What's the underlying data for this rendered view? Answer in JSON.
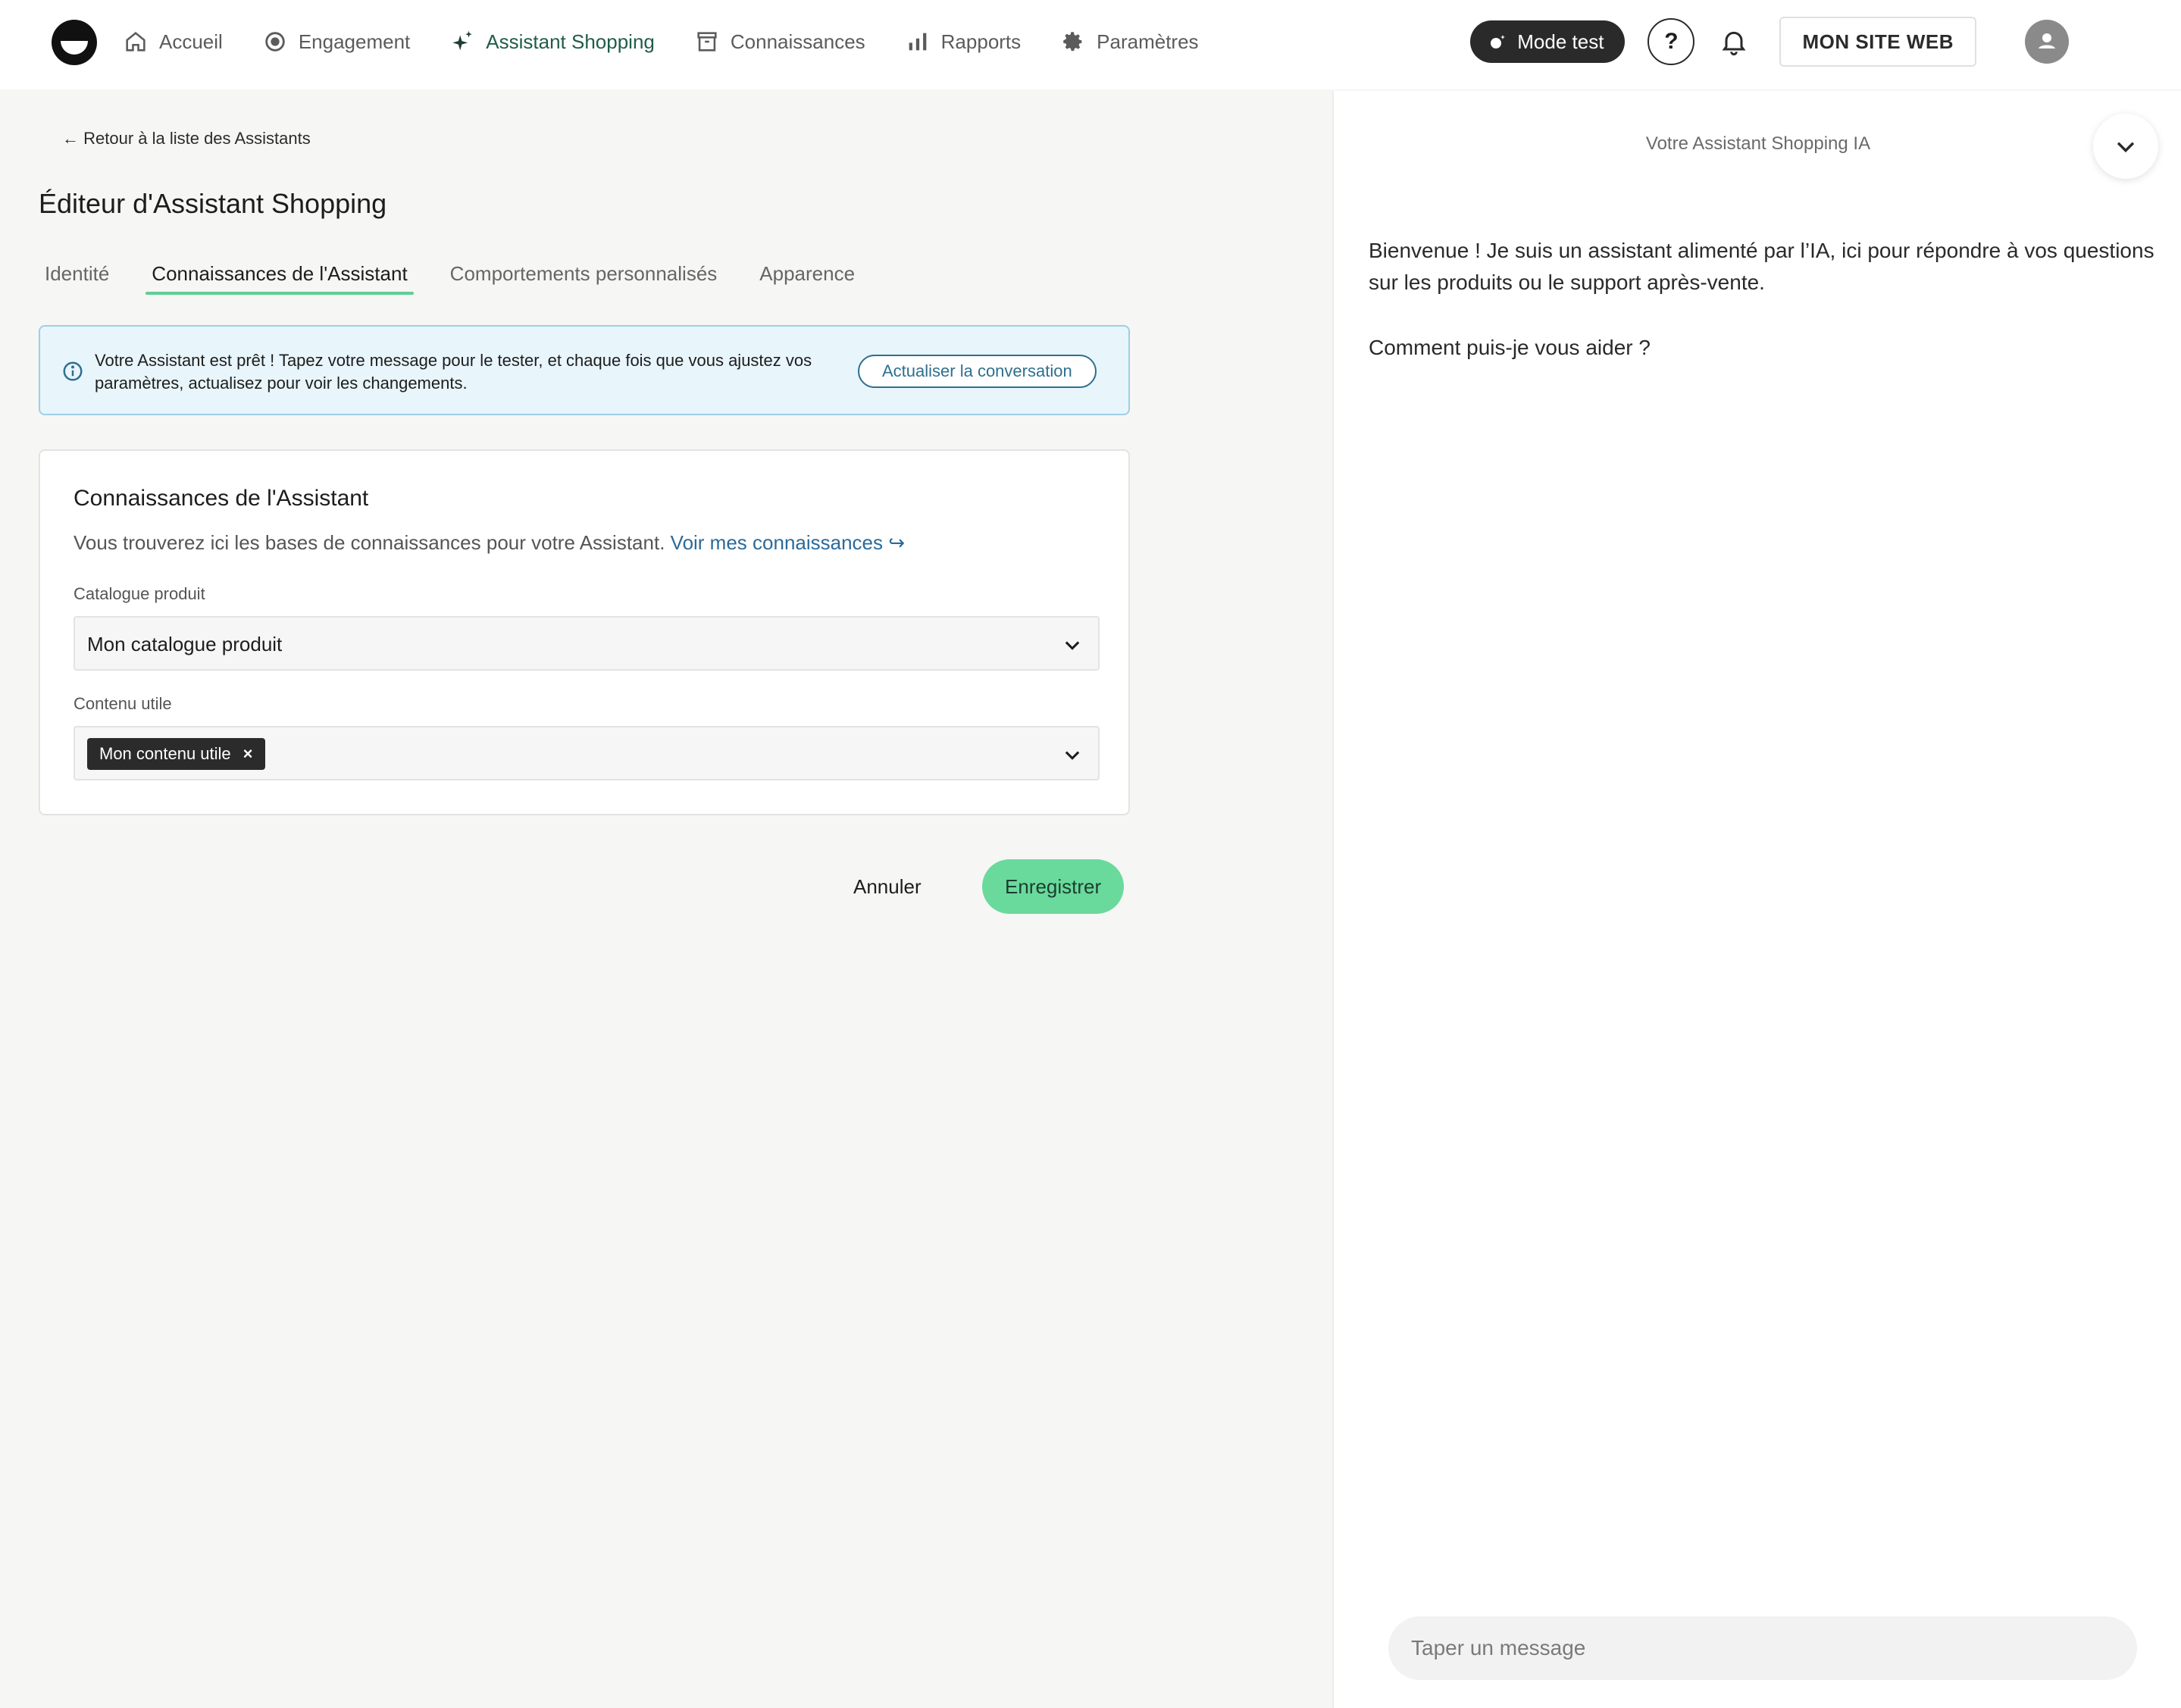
{
  "nav": {
    "items": [
      {
        "label": "Accueil",
        "icon": "home-icon"
      },
      {
        "label": "Engagement",
        "icon": "target-icon"
      },
      {
        "label": "Assistant Shopping",
        "icon": "sparkle-icon"
      },
      {
        "label": "Connaissances",
        "icon": "archive-icon"
      },
      {
        "label": "Rapports",
        "icon": "bar-chart-icon"
      },
      {
        "label": "Paramètres",
        "icon": "gear-icon"
      }
    ],
    "active_index": 2
  },
  "topbar": {
    "mode_test_label": "Mode test",
    "help_label": "?",
    "site_button_label": "MON SITE WEB"
  },
  "editor": {
    "back_link": "← Retour à la liste des Assistants",
    "title": "Éditeur d'Assistant Shopping",
    "tabs": [
      "Identité",
      "Connaissances de l'Assistant",
      "Comportements personnalisés",
      "Apparence"
    ],
    "active_tab": 1,
    "banner": {
      "text": "Votre Assistant est prêt ! Tapez votre message pour le tester, et chaque fois que vous ajustez vos paramètres, actualisez pour voir les changements.",
      "button": "Actualiser la conversation"
    },
    "card": {
      "title": "Connaissances de l'Assistant",
      "description": "Vous trouverez ici les bases de connaissances pour votre Assistant.",
      "link": "Voir mes connaissances",
      "catalog_label": "Catalogue produit",
      "catalog_value": "Mon catalogue produit",
      "content_label": "Contenu utile",
      "content_chip": "Mon contenu utile"
    },
    "cancel_label": "Annuler",
    "save_label": "Enregistrer"
  },
  "chat": {
    "header": "Votre Assistant Shopping IA",
    "messages": [
      "Bienvenue ! Je suis un assistant alimenté par l’IA, ici pour répondre à vos questions sur les produits ou le support après-vente.",
      "Comment puis-je vous aider ?"
    ],
    "input_placeholder": "Taper un message"
  },
  "colors": {
    "accent_green": "#69da9c",
    "active_nav": "#1f5e49",
    "link_blue": "#2c6a99",
    "banner_bg": "#e8f5fb"
  }
}
